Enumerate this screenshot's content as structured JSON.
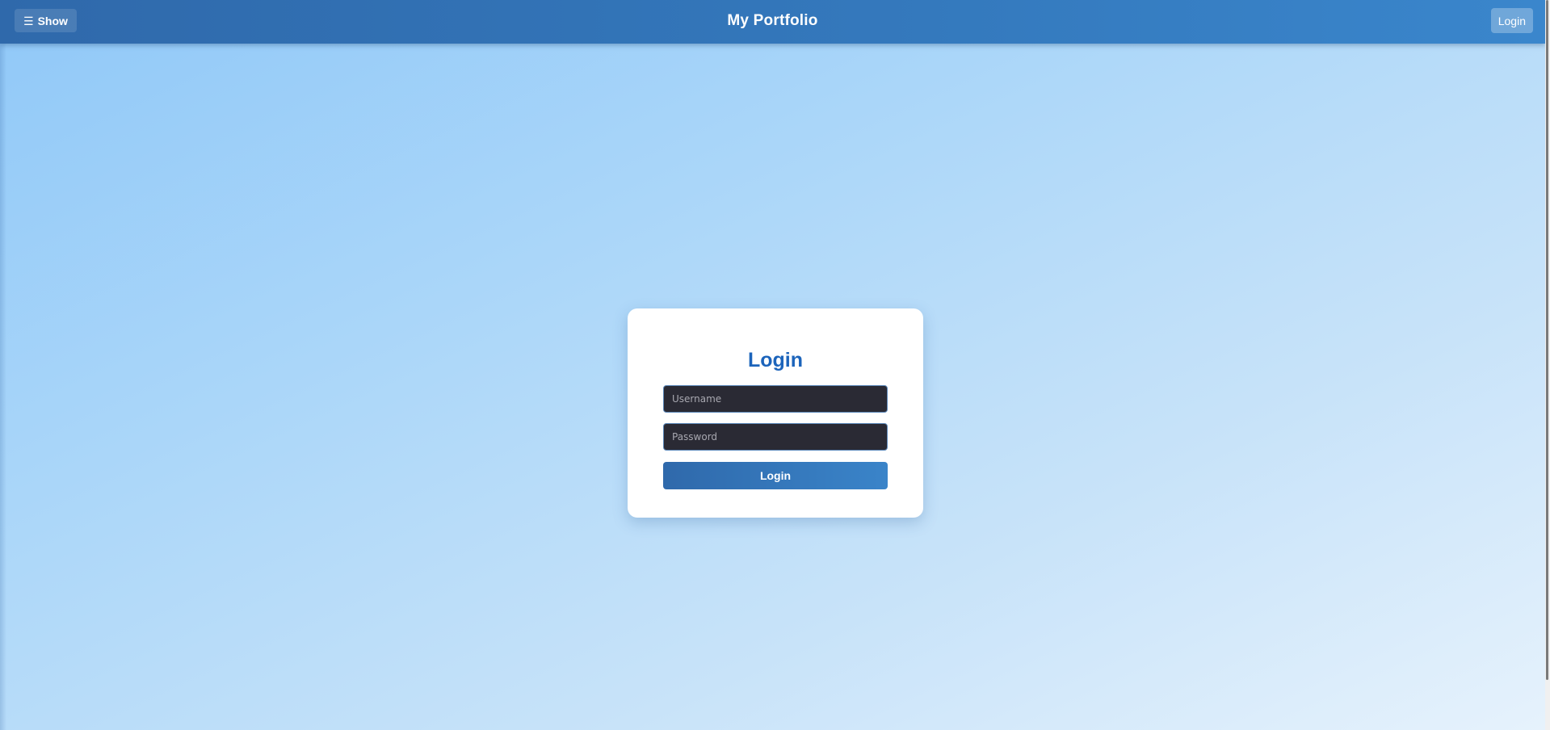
{
  "header": {
    "menu_icon": "hamburger-icon",
    "menu_icon_glyph": "☰",
    "show_label": "Show",
    "title": "My Portfolio",
    "login_label": "Login"
  },
  "login_form": {
    "title": "Login",
    "username_placeholder": "Username",
    "username_value": "",
    "password_placeholder": "Password",
    "password_value": "",
    "submit_label": "Login"
  },
  "colors": {
    "header_bar": "#3479bd",
    "title_accent": "#1c64bb",
    "input_background": "#2a2a34",
    "page_gradient_start": "#90c8f8",
    "page_gradient_end": "#e6f2fc"
  }
}
